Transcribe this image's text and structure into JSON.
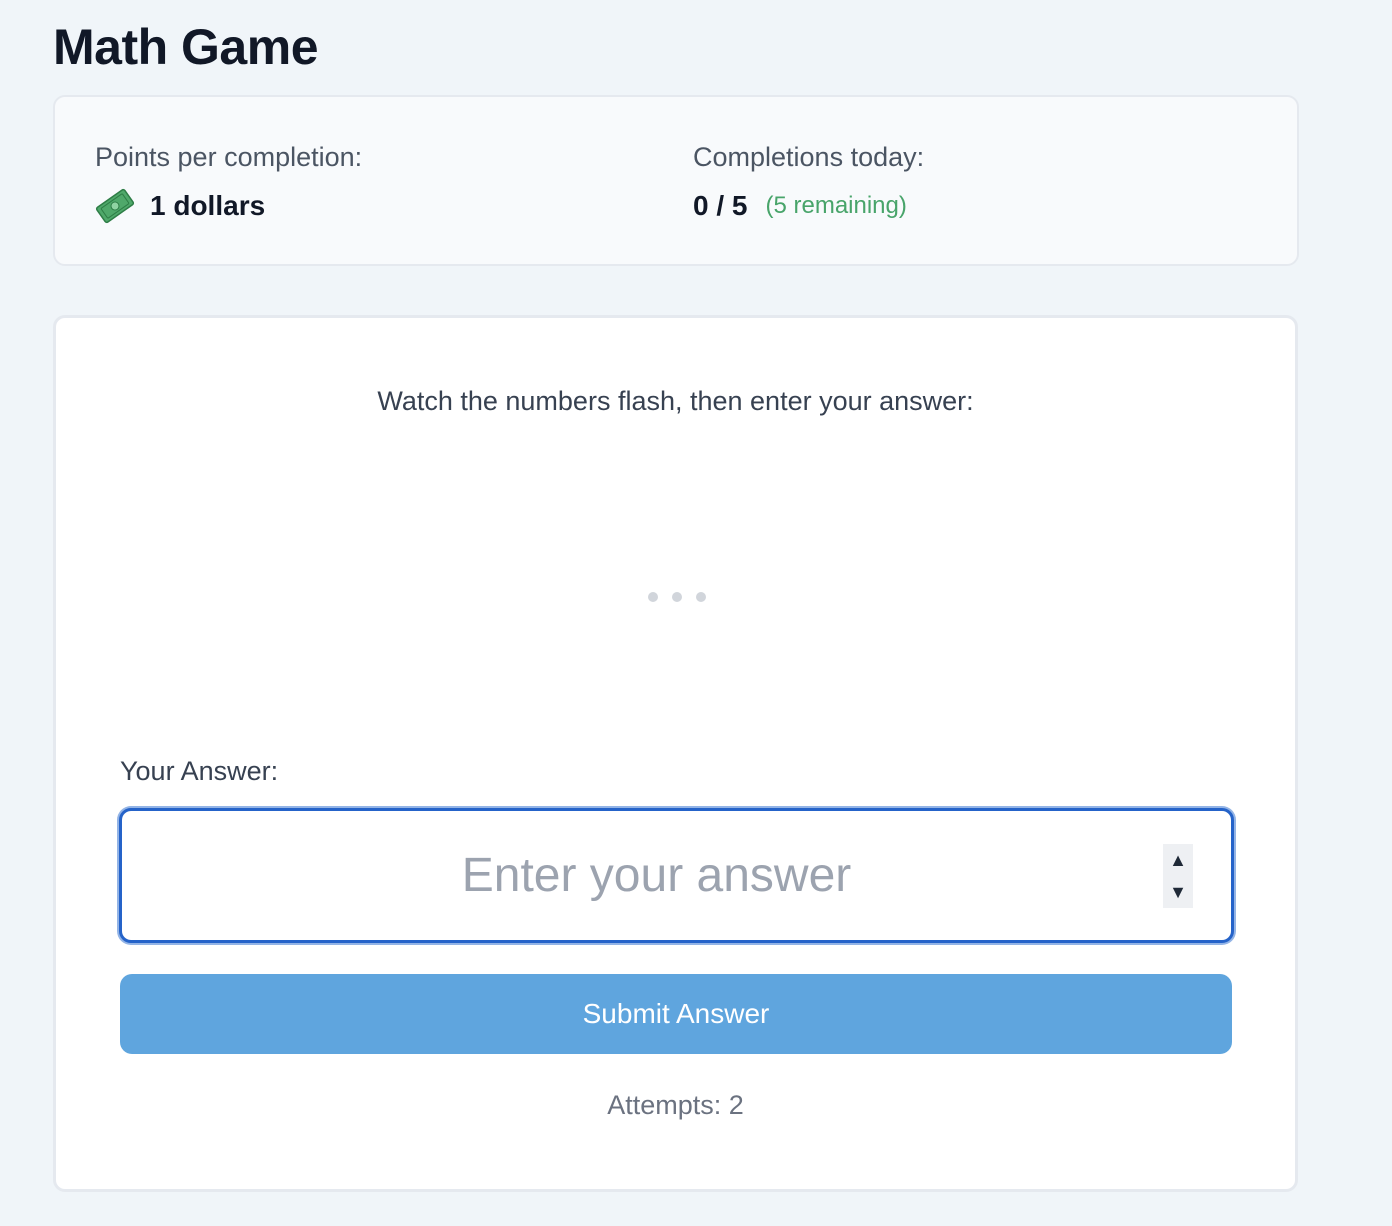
{
  "page": {
    "title": "Math Game"
  },
  "info": {
    "points_label": "Points per completion:",
    "points_icon": "money-bill-icon",
    "points_value": "1 dollars",
    "completions_label": "Completions today:",
    "completions_value": "0 / 5",
    "remaining_text": "(5 remaining)",
    "remaining_color": "#48a46a"
  },
  "game": {
    "instructions": "Watch the numbers flash, then enter your answer:",
    "answer_label": "Your Answer:",
    "answer_placeholder": "Enter your answer",
    "answer_value": "",
    "submit_label": "Submit Answer",
    "submit_color": "#5fa5de",
    "attempts_text": "Attempts: 2"
  }
}
